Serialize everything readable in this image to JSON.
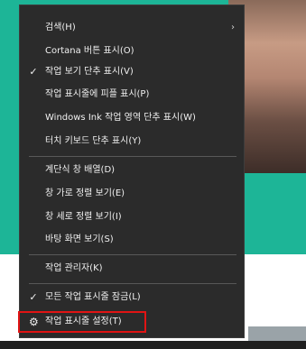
{
  "menu": {
    "items": [
      {
        "label": "검색(H)",
        "arrow": "›"
      },
      {
        "label": "Cortana 버튼 표시(O)"
      },
      {
        "label": "작업 보기 단추 표시(V)",
        "check": "✓"
      },
      {
        "label": "작업 표시줄에 피플 표시(P)"
      },
      {
        "label": "Windows Ink 작업 영역 단추 표시(W)"
      },
      {
        "label": "터치 키보드 단추 표시(Y)"
      },
      {
        "label": "계단식 창 배열(D)"
      },
      {
        "label": "창 가로 정렬 보기(E)"
      },
      {
        "label": "창 세로 정렬 보기(I)"
      },
      {
        "label": "바탕 화면 보기(S)"
      },
      {
        "label": "작업 관리자(K)"
      },
      {
        "label": "모든 작업 표시줄 잠금(L)",
        "check": "✓"
      },
      {
        "label": "작업 표시줄 설정(T)",
        "icon": "⚙"
      }
    ]
  },
  "icons": {
    "check": "checkmark-icon",
    "arrow": "chevron-right-icon",
    "gear": "gear-icon"
  },
  "colors": {
    "menu_bg": "#2b2b2b",
    "accent_teal": "#1db597",
    "highlight": "#e01414"
  }
}
